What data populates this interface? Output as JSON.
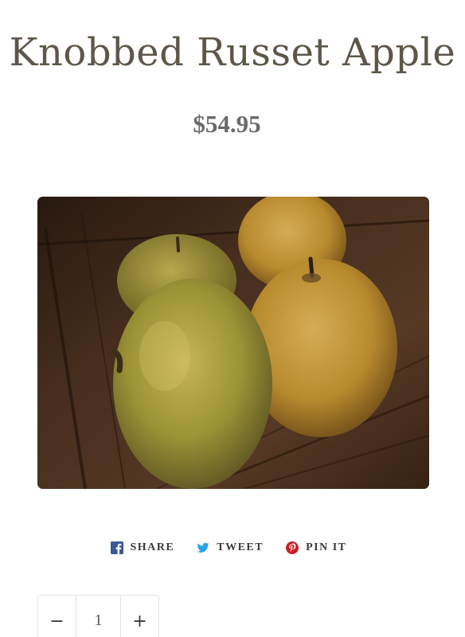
{
  "product": {
    "title": "Knobbed Russet Apple",
    "price": "$54.95",
    "image_icon": "apple-photo"
  },
  "share": {
    "items": [
      {
        "label": "SHARE",
        "icon": "facebook-icon",
        "color": "#3b5998"
      },
      {
        "label": "TWEET",
        "icon": "twitter-icon",
        "color": "#2aa3ef"
      },
      {
        "label": "PIN IT",
        "icon": "pinterest-icon",
        "color": "#cb2027"
      }
    ]
  },
  "quantity": {
    "minus_label": "−",
    "value": "1",
    "plus_label": "+"
  }
}
